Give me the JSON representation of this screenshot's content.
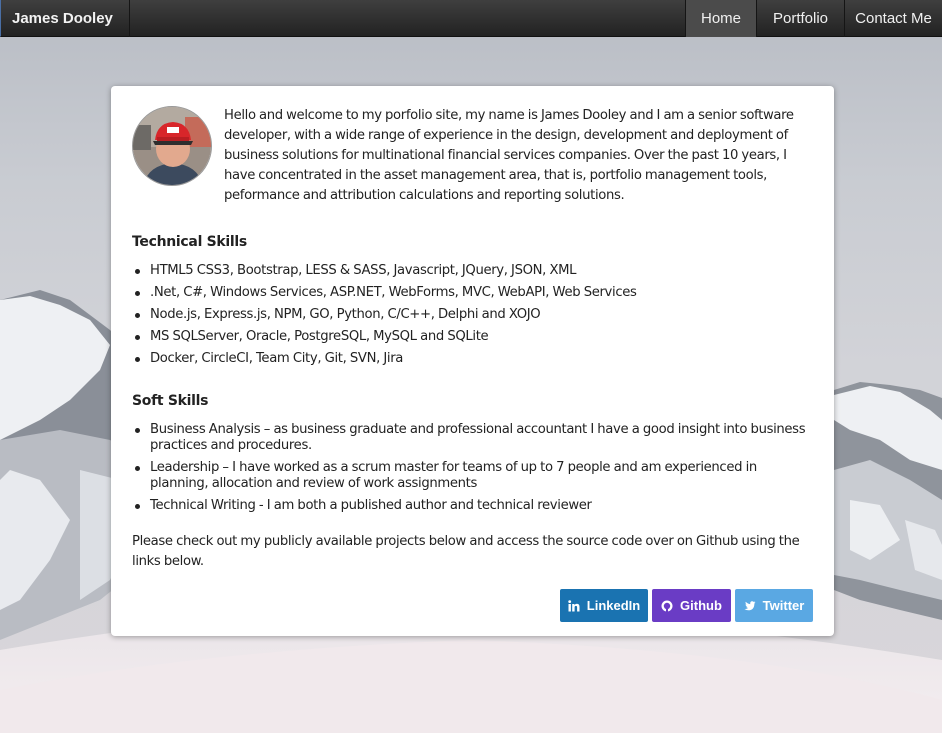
{
  "navbar": {
    "brand": "James Dooley",
    "items": [
      {
        "label": "Home",
        "active": true
      },
      {
        "label": "Portfolio",
        "active": false
      },
      {
        "label": "Contact Me",
        "active": false
      }
    ]
  },
  "profile": {
    "intro": "Hello and welcome to my porfolio site, my name is James Dooley and I am a senior software developer, with a wide range of experience in the design, development and deployment of business solutions for multinational financial services companies. Over the past 10 years, I have concentrated in the asset management area, that is, portfolio management tools, peformance and attribution calculations and reporting solutions."
  },
  "technical": {
    "heading": "Technical Skills",
    "items": [
      "HTML5 CSS3, Bootstrap, LESS & SASS, Javascript, JQuery, JSON, XML",
      ".Net, C#, Windows Services, ASP.NET, WebForms, MVC, WebAPI, Web Services",
      "Node.js, Express.js, NPM, GO, Python, C/C++, Delphi and XOJO",
      "MS SQLServer, Oracle, PostgreSQL, MySQL and SQLite",
      "Docker, CircleCI, Team City, Git, SVN, Jira"
    ]
  },
  "soft": {
    "heading": "Soft Skills",
    "items": [
      "Business Analysis – as business graduate and professional accountant I have a good insight into business practices and procedures.",
      "Leadership – I have worked as a scrum master for teams of up to 7 people and am experienced in planning, allocation and review of work assignments",
      "Technical Writing - I am both a published author and technical reviewer"
    ]
  },
  "outro": "Please check out my publicly available projects below and access the source code over on Github using the links below.",
  "social": {
    "linkedin": {
      "label": "LinkedIn",
      "icon": "linkedin-icon",
      "color": "#1a73b1"
    },
    "github": {
      "label": "Github",
      "icon": "github-icon",
      "color": "#6a3cc5"
    },
    "twitter": {
      "label": "Twitter",
      "icon": "twitter-icon",
      "color": "#5aa8e3"
    }
  }
}
